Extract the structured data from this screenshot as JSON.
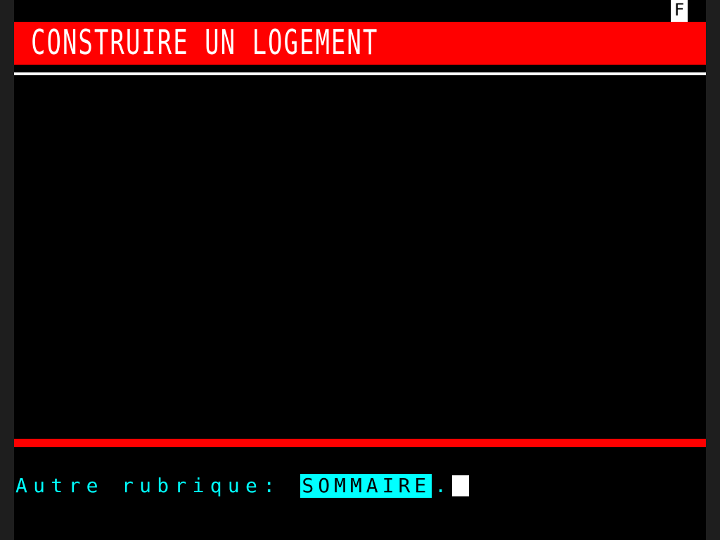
{
  "status": {
    "indicator": "F"
  },
  "header": {
    "title": "CONSTRUIRE UN LOGEMENT"
  },
  "footer": {
    "prompt_label": "Autre rubrique:",
    "key_label": "SOMMAIRE",
    "trailing": "."
  },
  "colors": {
    "background": "#000000",
    "title_bar": "#ff0000",
    "title_text": "#ffffff",
    "prompt_text": "#00ffff",
    "key_highlight": "#00ffff"
  }
}
